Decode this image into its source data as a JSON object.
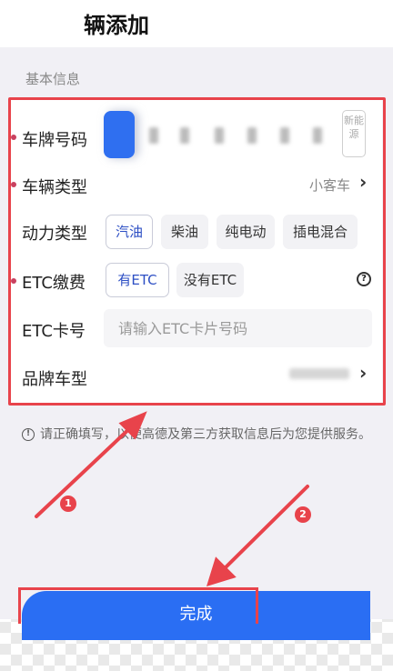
{
  "header": {
    "title": "辆添加"
  },
  "section": {
    "label": "基本信息"
  },
  "plate": {
    "label": "车牌号码",
    "new_energy_label": "新能源"
  },
  "vehicle_type": {
    "label": "车辆类型",
    "value": "小客车"
  },
  "power_type": {
    "label": "动力类型",
    "options": [
      "汽油",
      "柴油",
      "纯电动",
      "插电混合"
    ],
    "selected": "汽油"
  },
  "etc": {
    "label": "ETC缴费",
    "options": [
      "有ETC",
      "没有ETC"
    ],
    "selected": "有ETC"
  },
  "etc_card": {
    "label": "ETC卡号",
    "placeholder": "请输入ETC卡片号码"
  },
  "brand": {
    "label": "品牌车型"
  },
  "notice": {
    "text": "请正确填写，以便高德及第三方获取信息后为您提供服务。"
  },
  "footer": {
    "button_label": "完成"
  },
  "annotations": {
    "badge_1": "1",
    "badge_2": "2"
  },
  "colors": {
    "accent": "#2a6ef3",
    "highlight_red": "#e8434b",
    "required_dot": "#c9415f",
    "page_bg": "#f1f0f5"
  }
}
